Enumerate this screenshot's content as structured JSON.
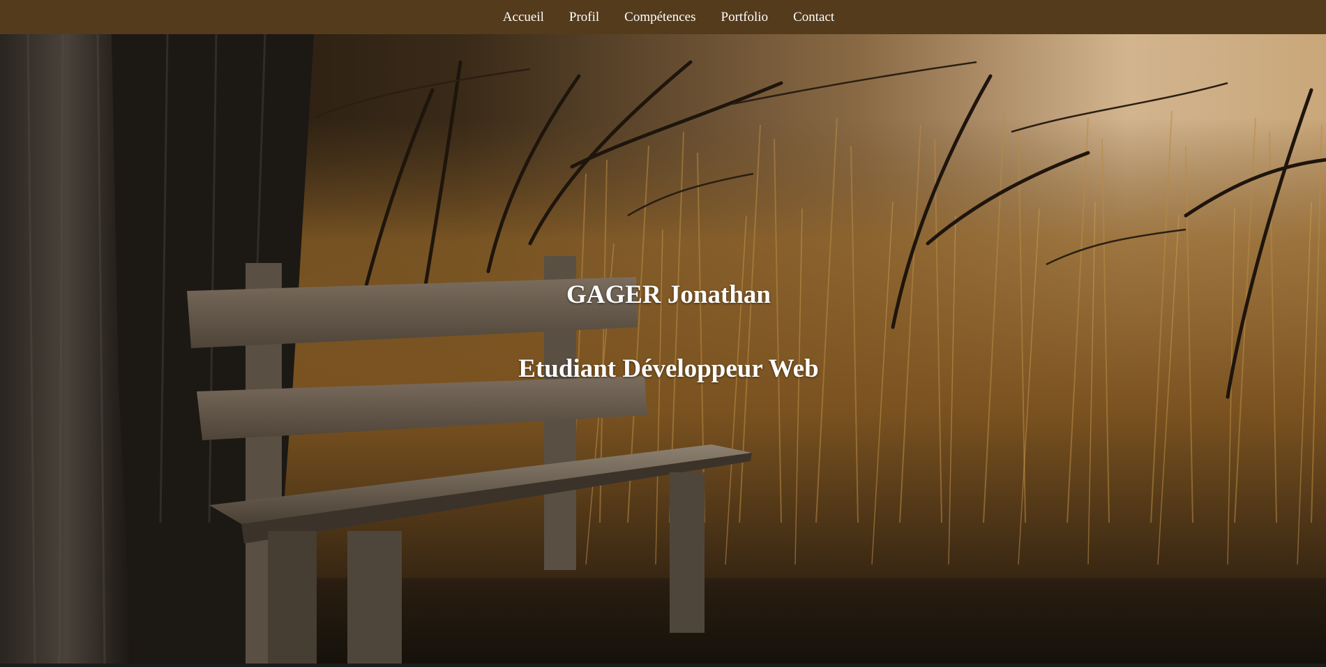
{
  "nav": {
    "items": [
      {
        "label": "Accueil",
        "name": "nav-link-accueil"
      },
      {
        "label": "Profil",
        "name": "nav-link-profil"
      },
      {
        "label": "Compétences",
        "name": "nav-link-competences"
      },
      {
        "label": "Portfolio",
        "name": "nav-link-portfolio"
      },
      {
        "label": "Contact",
        "name": "nav-link-contact"
      }
    ]
  },
  "hero": {
    "title": "GAGER Jonathan",
    "subtitle": "Etudiant Développeur Web",
    "background_image": "wooden-bench-in-dry-reeds-photo"
  },
  "colors": {
    "nav_background": "#543b1c",
    "nav_text": "#ffffff",
    "hero_text": "#ffffff",
    "bottom_strip": "#1c1c1c"
  }
}
